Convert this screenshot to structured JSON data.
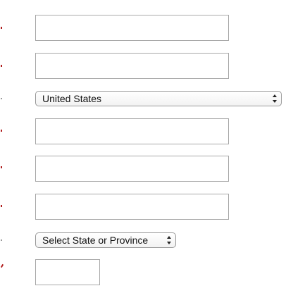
{
  "form": {
    "fields": [
      {
        "value": "",
        "placeholder": ""
      },
      {
        "value": "",
        "placeholder": ""
      },
      {
        "value": "",
        "placeholder": ""
      },
      {
        "value": "",
        "placeholder": ""
      },
      {
        "value": "",
        "placeholder": ""
      },
      {
        "value": "",
        "placeholder": ""
      }
    ],
    "country_select": {
      "selected": "United States"
    },
    "state_select": {
      "selected": "Select State or Province"
    }
  },
  "colors": {
    "required_mark": "#b01e1e",
    "input_border": "#a9a9a9"
  },
  "icons": {
    "select_arrow": "up-down-chevron-icon"
  }
}
